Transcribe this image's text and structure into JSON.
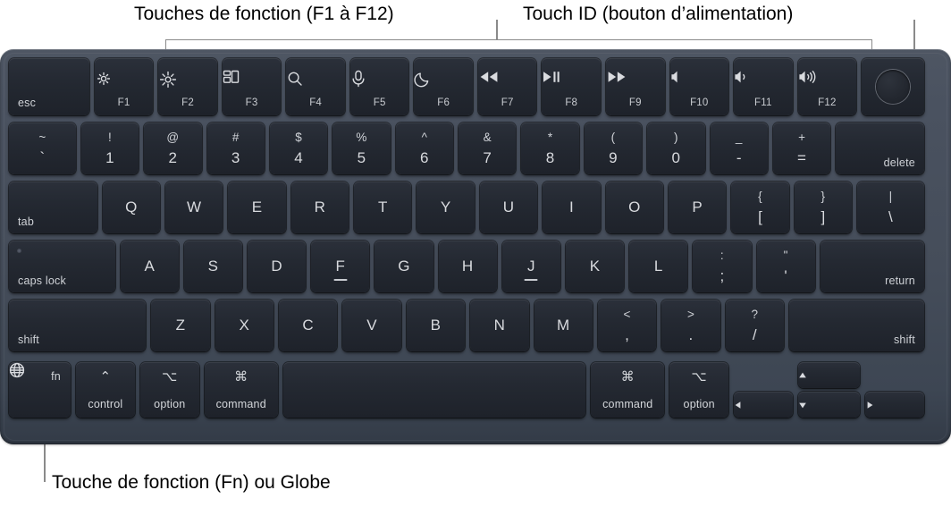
{
  "callouts": {
    "top_left": "Touches de fonction (F1 à F12)",
    "top_right": "Touch ID (bouton d’alimentation)",
    "bottom_left": "Touche de fonction (Fn) ou Globe"
  },
  "colors": {
    "body": "#4a5260",
    "key": "#242932",
    "key_text": "#d8dade",
    "leader": "#8a8a8a",
    "caption": "#000000"
  },
  "keyboard": {
    "layout": "US English (ANSI) – Magic Keyboard with Touch ID",
    "rows": [
      {
        "name": "function-row",
        "keys": [
          {
            "name": "esc",
            "label": "esc",
            "style": "bottom-left",
            "width": 7.6
          },
          {
            "name": "f1",
            "icon": "brightness-down-icon",
            "sub": "F1",
            "width": 5.55
          },
          {
            "name": "f2",
            "icon": "brightness-up-icon",
            "sub": "F2",
            "width": 5.55
          },
          {
            "name": "f3",
            "icon": "mission-control-icon",
            "sub": "F3",
            "width": 5.55
          },
          {
            "name": "f4",
            "icon": "spotlight-search-icon",
            "sub": "F4",
            "width": 5.55
          },
          {
            "name": "f5",
            "icon": "dictation-microphone-icon",
            "sub": "F5",
            "width": 5.55
          },
          {
            "name": "f6",
            "icon": "do-not-disturb-moon-icon",
            "sub": "F6",
            "width": 5.55
          },
          {
            "name": "f7",
            "icon": "rewind-icon",
            "sub": "F7",
            "width": 5.55
          },
          {
            "name": "f8",
            "icon": "play-pause-icon",
            "sub": "F8",
            "width": 5.55
          },
          {
            "name": "f9",
            "icon": "fast-forward-icon",
            "sub": "F9",
            "width": 5.55
          },
          {
            "name": "f10",
            "icon": "volume-mute-icon",
            "sub": "F10",
            "width": 5.55
          },
          {
            "name": "f11",
            "icon": "volume-down-icon",
            "sub": "F11",
            "width": 5.55
          },
          {
            "name": "f12",
            "icon": "volume-up-icon",
            "sub": "F12",
            "width": 5.55
          },
          {
            "name": "touch-id",
            "icon": "touch-id-icon",
            "width": 5.9
          }
        ]
      },
      {
        "name": "number-row",
        "keys": [
          {
            "name": "backtick",
            "upper": "~",
            "lower": "`",
            "width": 6.45
          },
          {
            "name": "digit-1",
            "upper": "!",
            "lower": "1",
            "width": 5.55
          },
          {
            "name": "digit-2",
            "upper": "@",
            "lower": "2",
            "width": 5.55
          },
          {
            "name": "digit-3",
            "upper": "#",
            "lower": "3",
            "width": 5.55
          },
          {
            "name": "digit-4",
            "upper": "$",
            "lower": "4",
            "width": 5.55
          },
          {
            "name": "digit-5",
            "upper": "%",
            "lower": "5",
            "width": 5.55
          },
          {
            "name": "digit-6",
            "upper": "^",
            "lower": "6",
            "width": 5.55
          },
          {
            "name": "digit-7",
            "upper": "&",
            "lower": "7",
            "width": 5.55
          },
          {
            "name": "digit-8",
            "upper": "*",
            "lower": "8",
            "width": 5.55
          },
          {
            "name": "digit-9",
            "upper": "(",
            "lower": "9",
            "width": 5.55
          },
          {
            "name": "digit-0",
            "upper": ")",
            "lower": "0",
            "width": 5.55
          },
          {
            "name": "minus",
            "upper": "_",
            "lower": "-",
            "width": 5.55
          },
          {
            "name": "equal",
            "upper": "+",
            "lower": "=",
            "width": 5.55
          },
          {
            "name": "delete",
            "label": "delete",
            "style": "bottom-right",
            "width": 8.5
          }
        ]
      },
      {
        "name": "qwerty-row",
        "keys": [
          {
            "name": "tab",
            "label": "tab",
            "style": "bottom-left",
            "width": 8.5
          },
          {
            "name": "key-q",
            "center": "Q",
            "width": 5.55
          },
          {
            "name": "key-w",
            "center": "W",
            "width": 5.55
          },
          {
            "name": "key-e",
            "center": "E",
            "width": 5.55
          },
          {
            "name": "key-r",
            "center": "R",
            "width": 5.55
          },
          {
            "name": "key-t",
            "center": "T",
            "width": 5.55
          },
          {
            "name": "key-y",
            "center": "Y",
            "width": 5.55
          },
          {
            "name": "key-u",
            "center": "U",
            "width": 5.55
          },
          {
            "name": "key-i",
            "center": "I",
            "width": 5.55
          },
          {
            "name": "key-o",
            "center": "O",
            "width": 5.55
          },
          {
            "name": "key-p",
            "center": "P",
            "width": 5.55
          },
          {
            "name": "bracket-left",
            "upper": "{",
            "lower": "[",
            "width": 5.55
          },
          {
            "name": "bracket-right",
            "upper": "}",
            "lower": "]",
            "width": 5.55
          },
          {
            "name": "backslash",
            "upper": "|",
            "lower": "\\",
            "width": 6.45
          }
        ]
      },
      {
        "name": "home-row",
        "keys": [
          {
            "name": "caps-lock",
            "label": "caps lock",
            "style": "bottom-left",
            "led": true,
            "width": 10.1
          },
          {
            "name": "key-a",
            "center": "A",
            "width": 5.55
          },
          {
            "name": "key-s",
            "center": "S",
            "width": 5.55
          },
          {
            "name": "key-d",
            "center": "D",
            "width": 5.55
          },
          {
            "name": "key-f",
            "center": "F",
            "homebar": true,
            "width": 5.55
          },
          {
            "name": "key-g",
            "center": "G",
            "width": 5.55
          },
          {
            "name": "key-h",
            "center": "H",
            "width": 5.55
          },
          {
            "name": "key-j",
            "center": "J",
            "homebar": true,
            "width": 5.55
          },
          {
            "name": "key-k",
            "center": "K",
            "width": 5.55
          },
          {
            "name": "key-l",
            "center": "L",
            "width": 5.55
          },
          {
            "name": "semicolon",
            "upper": ":",
            "lower": ";",
            "width": 5.55
          },
          {
            "name": "quote",
            "upper": "\"",
            "lower": "'",
            "width": 5.55
          },
          {
            "name": "return",
            "label": "return",
            "style": "bottom-right",
            "width": 9.9
          }
        ]
      },
      {
        "name": "shift-row",
        "keys": [
          {
            "name": "shift-left",
            "label": "shift",
            "style": "bottom-left",
            "width": 13.0
          },
          {
            "name": "key-z",
            "center": "Z",
            "width": 5.55
          },
          {
            "name": "key-x",
            "center": "X",
            "width": 5.55
          },
          {
            "name": "key-c",
            "center": "C",
            "width": 5.55
          },
          {
            "name": "key-v",
            "center": "V",
            "width": 5.55
          },
          {
            "name": "key-b",
            "center": "B",
            "width": 5.55
          },
          {
            "name": "key-n",
            "center": "N",
            "width": 5.55
          },
          {
            "name": "key-m",
            "center": "M",
            "width": 5.55
          },
          {
            "name": "comma",
            "upper": "<",
            "lower": ",",
            "width": 5.55
          },
          {
            "name": "period",
            "upper": ">",
            "lower": ".",
            "width": 5.55
          },
          {
            "name": "slash",
            "upper": "?",
            "lower": "/",
            "width": 5.55
          },
          {
            "name": "shift-right",
            "label": "shift",
            "style": "bottom-right",
            "width": 12.8
          }
        ]
      },
      {
        "name": "bottom-row",
        "keys": [
          {
            "name": "fn-globe",
            "fn_label": "fn",
            "icon": "globe-icon",
            "width": 6.9
          },
          {
            "name": "control",
            "symbol": "⌃",
            "word": "control",
            "width": 6.6
          },
          {
            "name": "option-left",
            "symbol": "⌥",
            "word": "option",
            "width": 6.6
          },
          {
            "name": "command-left",
            "symbol": "⌘",
            "word": "command",
            "width": 8.2
          },
          {
            "name": "space",
            "width": 33.9
          },
          {
            "name": "command-right",
            "symbol": "⌘",
            "word": "command",
            "width": 8.2
          },
          {
            "name": "option-right",
            "symbol": "⌥",
            "word": "option",
            "width": 6.6
          },
          {
            "name": "arrow-left",
            "icon": "arrow-left-icon",
            "width": 6.6
          },
          {
            "name": "arrow-up-down",
            "icon": "arrow-up-down-icon",
            "width": 6.9
          },
          {
            "name": "arrow-right",
            "icon": "arrow-right-icon",
            "width": 6.6
          }
        ]
      }
    ]
  }
}
